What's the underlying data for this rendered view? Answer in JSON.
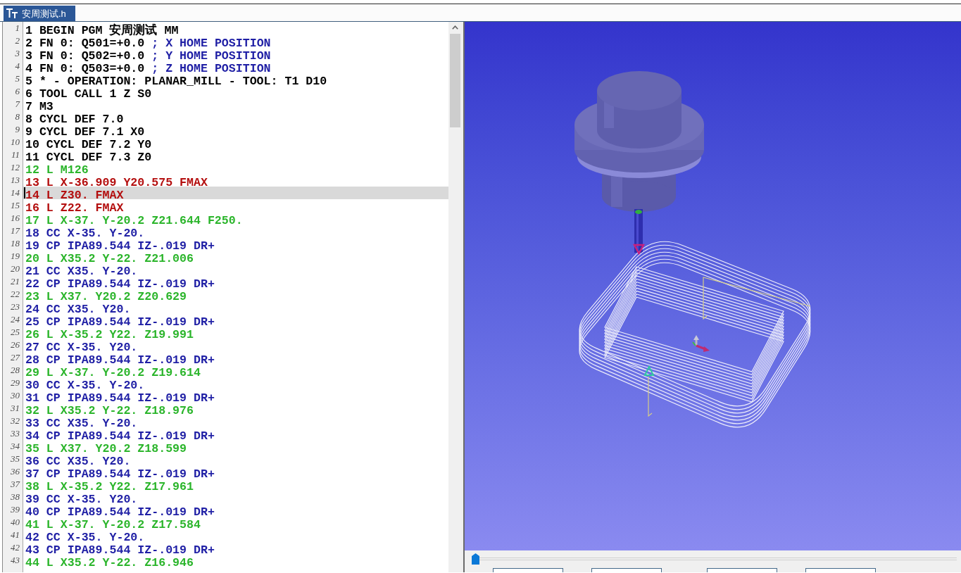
{
  "editor": {
    "tab": {
      "title": "安周测试.h",
      "selected": true
    },
    "lines": [
      {
        "number": "1",
        "text": "1 BEGIN PGM 安周测试 MM",
        "kind": "plain",
        "selected": false
      },
      {
        "number": "2",
        "text": "2 FN 0: Q501=+0.0",
        "comment": "; X HOME POSITION",
        "kind": "plain",
        "selected": false
      },
      {
        "number": "3",
        "text": "3 FN 0: Q502=+0.0",
        "comment": "; Y HOME POSITION",
        "kind": "plain",
        "selected": false
      },
      {
        "number": "4",
        "text": "4 FN 0: Q503=+0.0",
        "comment": "; Z HOME POSITION",
        "kind": "plain",
        "selected": false
      },
      {
        "number": "5",
        "text": "5 * - OPERATION: PLANAR_MILL - TOOL: T1 D10",
        "kind": "plain",
        "selected": false
      },
      {
        "number": "6",
        "text": "6 TOOL CALL 1 Z S0",
        "kind": "plain",
        "selected": false
      },
      {
        "number": "7",
        "text": "7 M3",
        "kind": "plain",
        "selected": false
      },
      {
        "number": "8",
        "text": "8 CYCL DEF 7.0",
        "kind": "plain",
        "selected": false
      },
      {
        "number": "9",
        "text": "9 CYCL DEF 7.1 X0",
        "kind": "plain",
        "selected": false
      },
      {
        "number": "10",
        "text": "10 CYCL DEF 7.2 Y0",
        "kind": "plain",
        "selected": false
      },
      {
        "number": "11",
        "text": "11 CYCL DEF 7.3 Z0",
        "kind": "plain",
        "selected": false
      },
      {
        "number": "12",
        "text": "12 L M126",
        "kind": "linear",
        "selected": false
      },
      {
        "number": "13",
        "text": "13 L X-36.909 Y20.575 FMAX",
        "kind": "rapid",
        "selected": false
      },
      {
        "number": "14",
        "text": "14 L Z30. FMAX",
        "kind": "rapid",
        "selected": true
      },
      {
        "number": "15",
        "text": "16 L Z22. FMAX",
        "kind": "rapid",
        "selected": false
      },
      {
        "number": "16",
        "text": "17 L X-37. Y-20.2 Z21.644 F250.",
        "kind": "linear",
        "selected": false
      },
      {
        "number": "17",
        "text": "18 CC X-35. Y-20.",
        "kind": "arc",
        "selected": false
      },
      {
        "number": "18",
        "text": "19 CP IPA89.544 IZ-.019 DR+",
        "kind": "arc",
        "selected": false
      },
      {
        "number": "19",
        "text": "20 L X35.2 Y-22. Z21.006",
        "kind": "linear",
        "selected": false
      },
      {
        "number": "20",
        "text": "21 CC X35. Y-20.",
        "kind": "arc",
        "selected": false
      },
      {
        "number": "21",
        "text": "22 CP IPA89.544 IZ-.019 DR+",
        "kind": "arc",
        "selected": false
      },
      {
        "number": "22",
        "text": "23 L X37. Y20.2 Z20.629",
        "kind": "linear",
        "selected": false
      },
      {
        "number": "23",
        "text": "24 CC X35. Y20.",
        "kind": "arc",
        "selected": false
      },
      {
        "number": "24",
        "text": "25 CP IPA89.544 IZ-.019 DR+",
        "kind": "arc",
        "selected": false
      },
      {
        "number": "25",
        "text": "26 L X-35.2 Y22. Z19.991",
        "kind": "linear",
        "selected": false
      },
      {
        "number": "26",
        "text": "27 CC X-35. Y20.",
        "kind": "arc",
        "selected": false
      },
      {
        "number": "27",
        "text": "28 CP IPA89.544 IZ-.019 DR+",
        "kind": "arc",
        "selected": false
      },
      {
        "number": "28",
        "text": "29 L X-37. Y-20.2 Z19.614",
        "kind": "linear",
        "selected": false
      },
      {
        "number": "29",
        "text": "30 CC X-35. Y-20.",
        "kind": "arc",
        "selected": false
      },
      {
        "number": "30",
        "text": "31 CP IPA89.544 IZ-.019 DR+",
        "kind": "arc",
        "selected": false
      },
      {
        "number": "31",
        "text": "32 L X35.2 Y-22. Z18.976",
        "kind": "linear",
        "selected": false
      },
      {
        "number": "32",
        "text": "33 CC X35. Y-20.",
        "kind": "arc",
        "selected": false
      },
      {
        "number": "33",
        "text": "34 CP IPA89.544 IZ-.019 DR+",
        "kind": "arc",
        "selected": false
      },
      {
        "number": "34",
        "text": "35 L X37. Y20.2 Z18.599",
        "kind": "linear",
        "selected": false
      },
      {
        "number": "35",
        "text": "36 CC X35. Y20.",
        "kind": "arc",
        "selected": false
      },
      {
        "number": "36",
        "text": "37 CP IPA89.544 IZ-.019 DR+",
        "kind": "arc",
        "selected": false
      },
      {
        "number": "37",
        "text": "38 L X-35.2 Y22. Z17.961",
        "kind": "linear",
        "selected": false
      },
      {
        "number": "38",
        "text": "39 CC X-35. Y20.",
        "kind": "arc",
        "selected": false
      },
      {
        "number": "39",
        "text": "40 CP IPA89.544 IZ-.019 DR+",
        "kind": "arc",
        "selected": false
      },
      {
        "number": "40",
        "text": "41 L X-37. Y-20.2 Z17.584",
        "kind": "linear",
        "selected": false
      },
      {
        "number": "41",
        "text": "42 CC X-35. Y-20.",
        "kind": "arc",
        "selected": false
      },
      {
        "number": "42",
        "text": "43 CP IPA89.544 IZ-.019 DR+",
        "kind": "arc",
        "selected": false
      },
      {
        "number": "43",
        "text": "44 L X35.2 Y-22. Z16.946",
        "kind": "linear",
        "selected": false
      }
    ]
  },
  "viewer": {
    "timeline_slider": {
      "level": 0
    }
  }
}
